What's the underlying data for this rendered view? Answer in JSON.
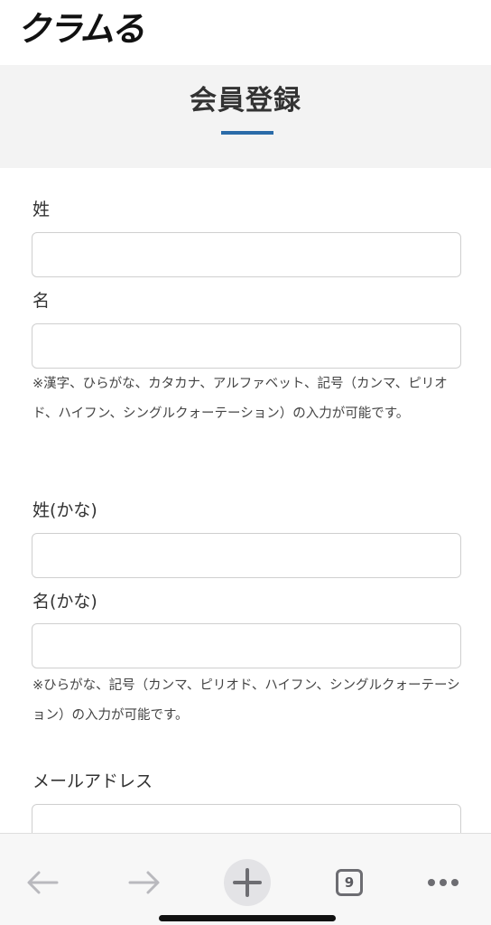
{
  "app": {
    "logo_text": "クラムる"
  },
  "page": {
    "title": "会員登録"
  },
  "form": {
    "last_name_label": "姓",
    "first_name_label": "名",
    "name_note": "※漢字、ひらがな、カタカナ、アルファベット、記号（カンマ、ピリオド、ハイフン、シングルクォーテーション）の入力が可能です。",
    "last_name_kana_label": "姓(かな)",
    "first_name_kana_label": "名(かな)",
    "kana_note": "※ひらがな、記号（カンマ、ピリオド、ハイフン、シングルクォーテーション）の入力が可能です。",
    "email_label": "メールアドレス",
    "last_name_value": "",
    "first_name_value": "",
    "last_name_kana_value": "",
    "first_name_kana_value": "",
    "email_value": ""
  },
  "browser_toolbar": {
    "tab_count": "9",
    "icons": [
      "back-arrow-icon",
      "forward-arrow-icon",
      "plus-icon",
      "tabs-icon",
      "more-icon"
    ],
    "icon_color": "#6d6d72",
    "disabled_color": "#b9b9be"
  }
}
